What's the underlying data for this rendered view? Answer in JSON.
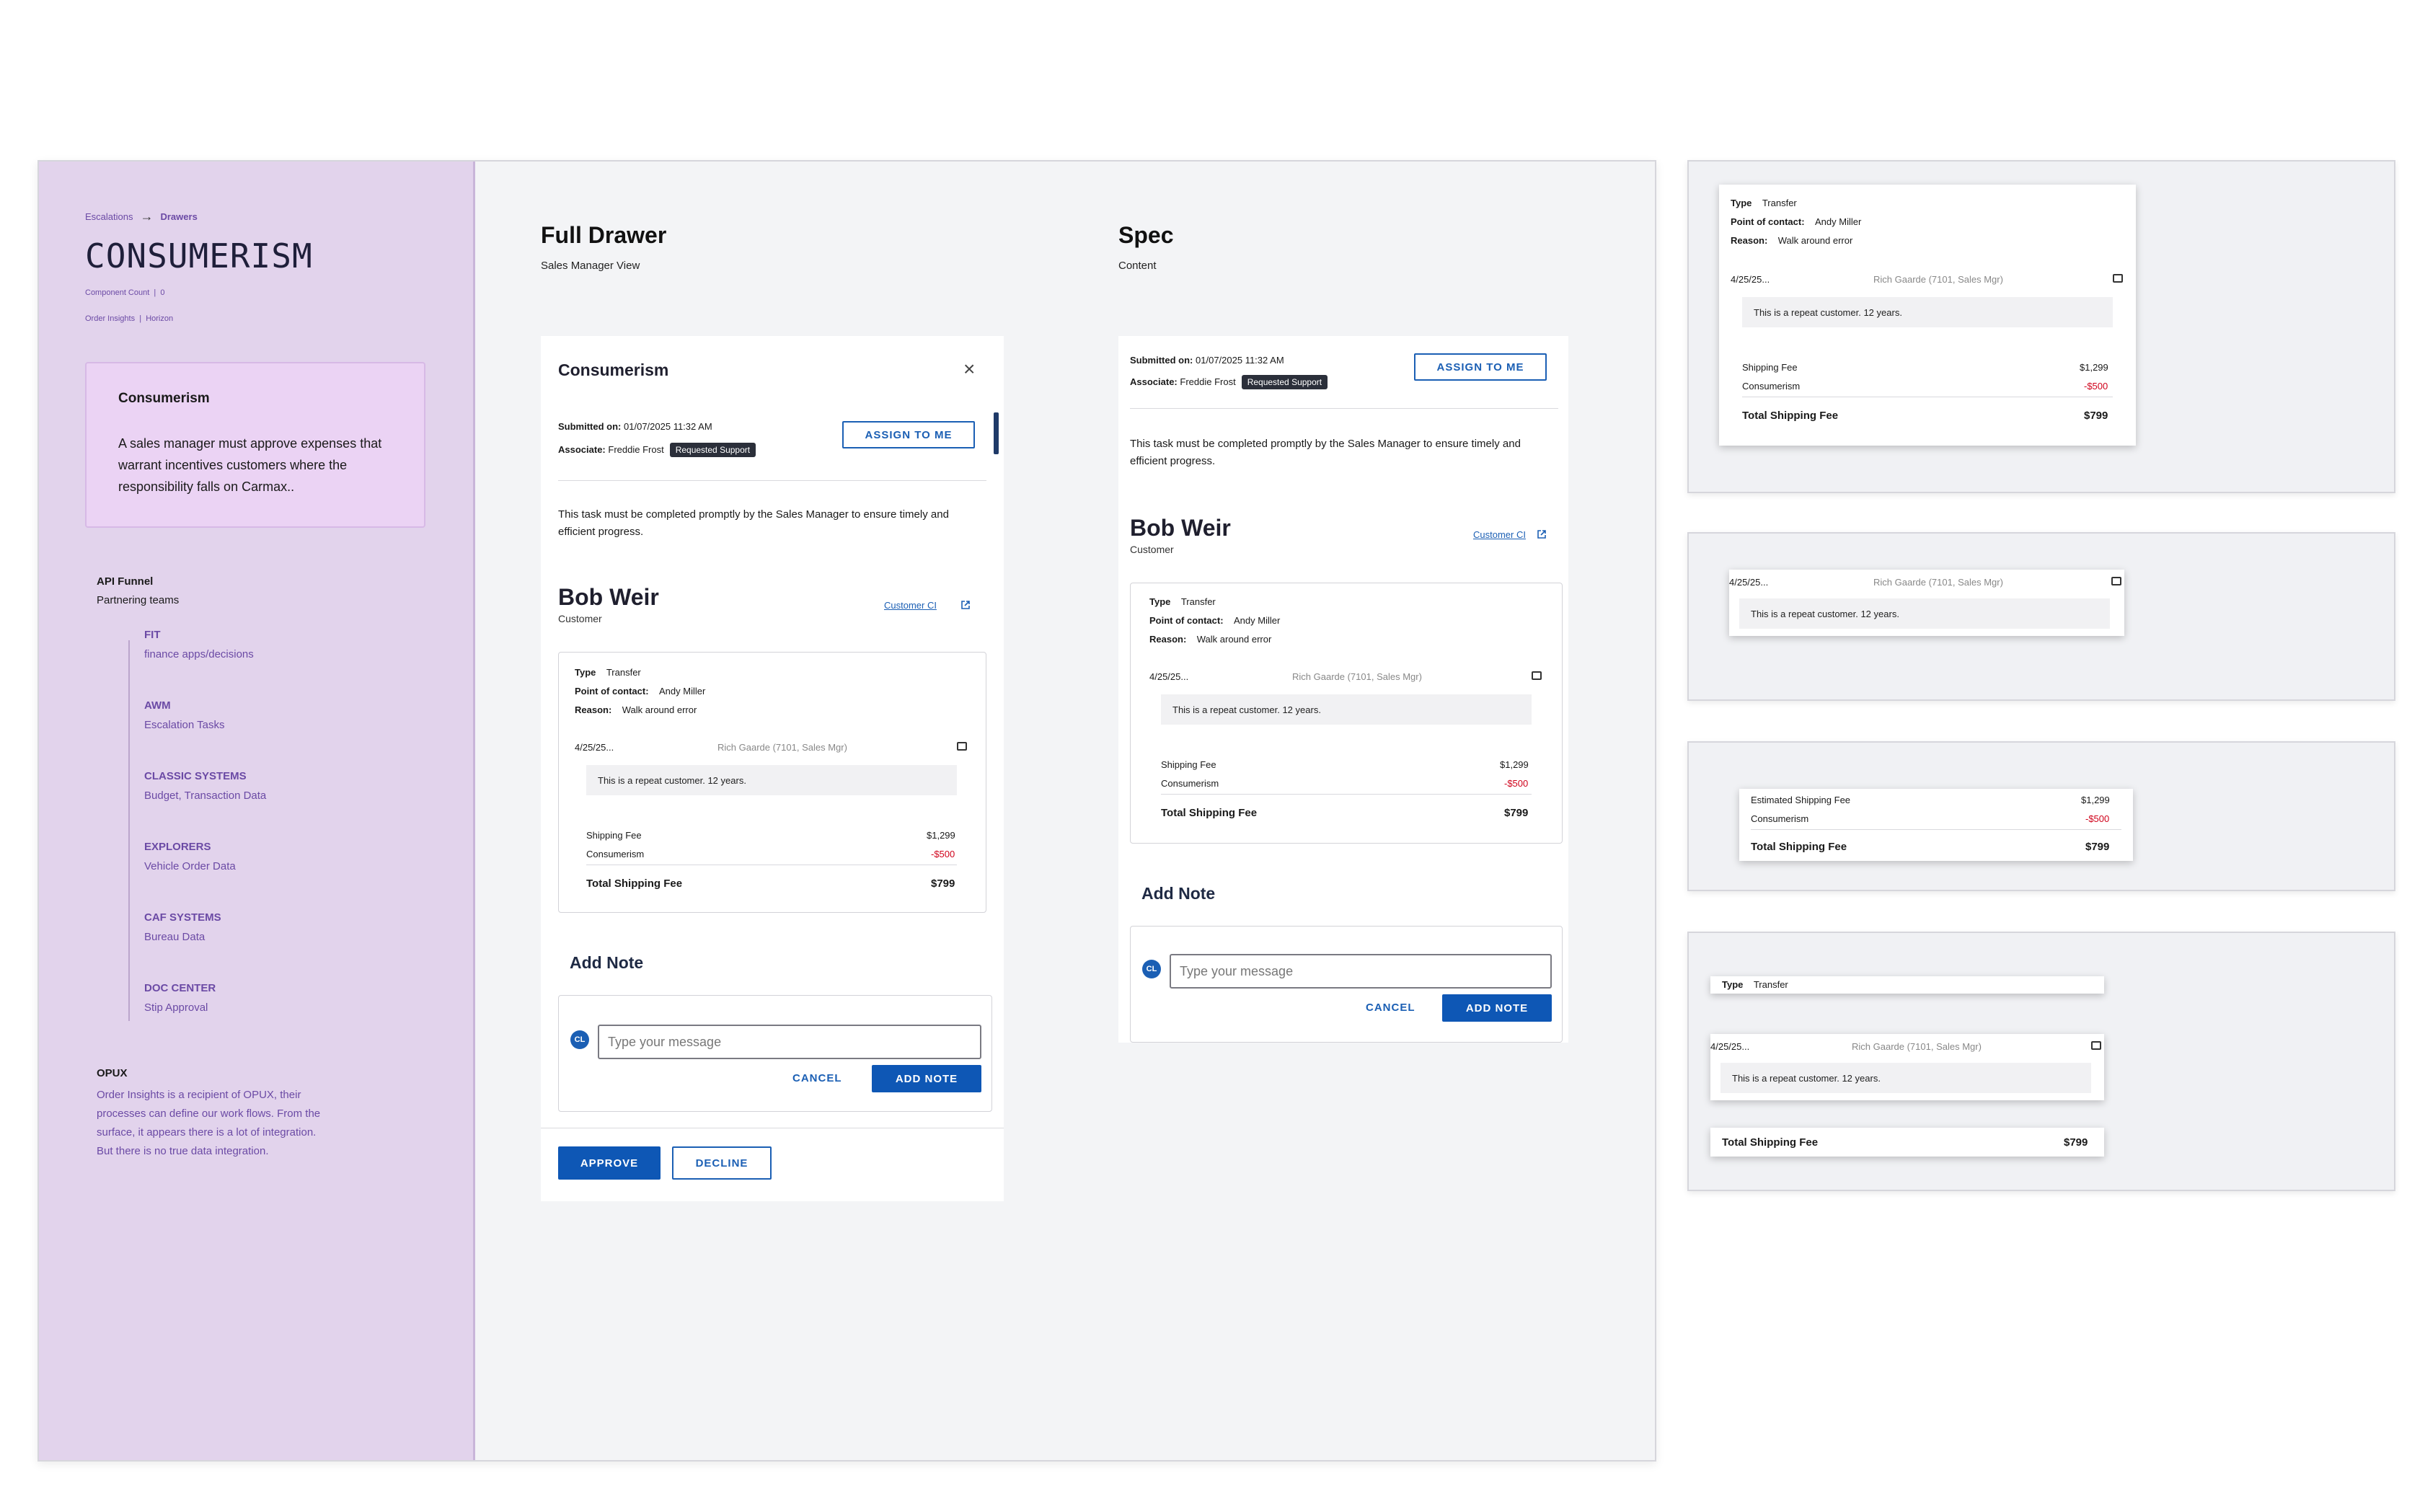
{
  "sidebar": {
    "breadcrumb_root": "Escalations",
    "breadcrumb_current": "Drawers",
    "brand": "CONSUMERISM",
    "component_count_label": "Component Count",
    "component_count_value": "0",
    "meta_a": "Order Insights",
    "meta_b": "Horizon",
    "card_title": "Consumerism",
    "card_text": "A sales manager must approve expenses that warrant incentives customers where the responsibility falls on Carmax..",
    "funnel_title": "API Funnel",
    "funnel_sub": "Partnering teams",
    "tree": [
      {
        "title": "FIT",
        "sub": "finance apps/decisions"
      },
      {
        "title": "AWM",
        "sub": "Escalation Tasks"
      },
      {
        "title": "CLASSIC SYSTEMS",
        "sub": "Budget, Transaction Data"
      },
      {
        "title": "EXPLORERS",
        "sub": "Vehicle Order Data"
      },
      {
        "title": "CAF SYSTEMS",
        "sub": "Bureau Data"
      },
      {
        "title": "DOC CENTER",
        "sub": "Stip Approval"
      }
    ],
    "opux_title": "OPUX",
    "opux_text": "Order Insights is a recipient of OPUX, their processes can define our work flows. From the surface, it appears there is a lot of integration. But there is no true data integration."
  },
  "full": {
    "title": "Full Drawer",
    "sub": "Sales Manager View"
  },
  "spec": {
    "title": "Spec",
    "sub": "Content"
  },
  "drawer": {
    "title": "Consumerism",
    "submitted_label": "Submitted on:",
    "submitted_value": "01/07/2025 11:32 AM",
    "associate_label": "Associate:",
    "associate_value": "Freddie Frost",
    "badge": "Requested Support",
    "assign_label": "ASSIGN TO ME",
    "description": "This task must be completed promptly by the Sales Manager to ensure timely and efficient progress.",
    "customer_name": "Bob Weir",
    "customer_role": "Customer",
    "customer_link": "Customer CI",
    "type_label": "Type",
    "type_value": "Transfer",
    "poc_label": "Point of contact:",
    "poc_value": "Andy Miller",
    "reason_label": "Reason:",
    "reason_value": "Walk around error",
    "note_date": "4/25/25...",
    "note_author": "Rich Gaarde (7101, Sales Mgr)",
    "note_text": "This is a repeat customer. 12 years.",
    "fee_label": "Shipping Fee",
    "fee_value": "$1,299",
    "est_fee_label": "Estimated Shipping Fee",
    "discount_label": "Consumerism",
    "discount_value": "-$500",
    "total_label": "Total Shipping Fee",
    "total_value": "$799",
    "add_note_title": "Add Note",
    "avatar": "CL",
    "message_placeholder": "Type your message",
    "cancel_label": "CANCEL",
    "add_note_label": "ADD NOTE",
    "approve_label": "APPROVE",
    "decline_label": "DECLINE"
  },
  "colors": {
    "accent": "#0e57b5",
    "sidebar_bg": "#e2d3ec",
    "negative": "#d0021b"
  }
}
